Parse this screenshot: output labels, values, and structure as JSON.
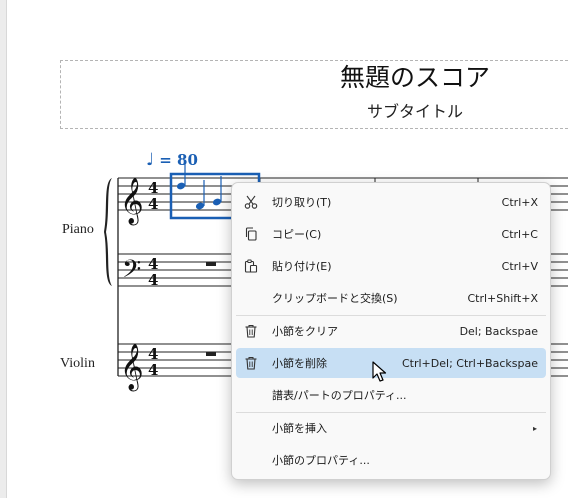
{
  "score": {
    "title": "無題のスコア",
    "subtitle": "サブタイトル",
    "tempo_value": "= 80",
    "instruments": [
      "Piano",
      "Violin"
    ]
  },
  "context_menu": {
    "items": [
      {
        "label": "切り取り(T)",
        "shortcut": "Ctrl+X",
        "icon": "scissors-icon"
      },
      {
        "label": "コピー(C)",
        "shortcut": "Ctrl+C",
        "icon": "copy-icon"
      },
      {
        "label": "貼り付け(E)",
        "shortcut": "Ctrl+V",
        "icon": "paste-icon"
      },
      {
        "label": "クリップボードと交換(S)",
        "shortcut": "Ctrl+Shift+X",
        "icon": ""
      },
      {
        "label": "小節をクリア",
        "shortcut": "Del; Backspae",
        "icon": "trash-icon"
      },
      {
        "label": "小節を削除",
        "shortcut": "Ctrl+Del; Ctrl+Backspae",
        "icon": "trash-icon",
        "highlighted": true
      },
      {
        "label": "譜表/パートのプロパティ...",
        "shortcut": "",
        "icon": ""
      },
      {
        "label": "小節を挿入",
        "shortcut": "",
        "icon": "",
        "submenu_arrow": "▸"
      },
      {
        "label": "小節のプロパティ...",
        "shortcut": "",
        "icon": ""
      }
    ]
  },
  "colors": {
    "selection": "#1a5fb4",
    "highlight": "#c7dff4"
  }
}
